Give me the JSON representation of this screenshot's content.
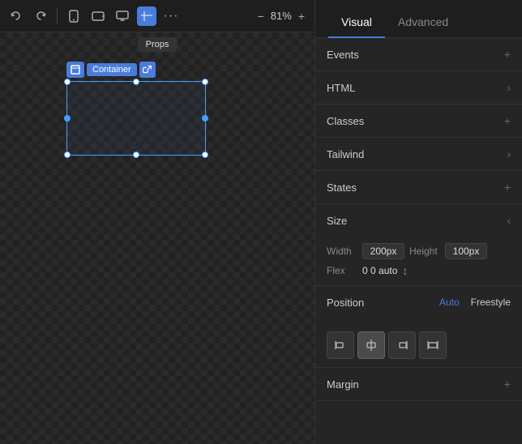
{
  "toolbar": {
    "undo_icon": "↩",
    "redo_icon": "↪",
    "zoom_percent": "81%",
    "zoom_minus": "−",
    "zoom_plus": "+",
    "props_tooltip": "Props"
  },
  "canvas": {
    "container_label": "Container"
  },
  "panel": {
    "tab_visual": "Visual",
    "tab_advanced": "Advanced",
    "events_label": "Events",
    "html_label": "HTML",
    "classes_label": "Classes",
    "tailwind_label": "Tailwind",
    "states_label": "States",
    "size_label": "Size",
    "width_label": "Width",
    "width_value": "200px",
    "height_label": "Height",
    "height_value": "100px",
    "flex_label": "Flex",
    "flex_value": "0 0 auto",
    "position_label": "Position",
    "position_auto": "Auto",
    "position_freestyle": "Freestyle",
    "margin_label": "Margin"
  }
}
